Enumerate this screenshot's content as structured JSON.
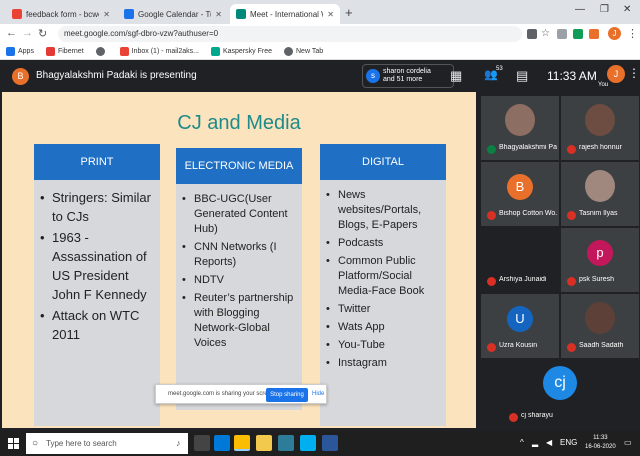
{
  "browser": {
    "tabs": [
      {
        "label": "feedback form - bcwcc.journalis",
        "favicon_color": "#ea4335"
      },
      {
        "label": "Google Calendar - Tuesday, June",
        "favicon_color": "#1a73e8"
      },
      {
        "label": "Meet - International Webinar",
        "favicon_color": "#00897b",
        "active": true
      }
    ],
    "new_tab": "+",
    "window_controls": {
      "minimize": "—",
      "maximize": "❐",
      "close": "✕"
    },
    "url": "meet.google.com/sgf-dbro-vzw?authuser=0",
    "profile_letter": "J",
    "bookmarks": [
      {
        "label": "Apps",
        "color": "#1a73e8"
      },
      {
        "label": "Fibernet",
        "color": "#e53935"
      },
      {
        "label": "",
        "color": "#5f6368"
      },
      {
        "label": "Inbox (1) - mail2aks...",
        "color": "#ea4335"
      },
      {
        "label": "Kaspersky Free",
        "color": "#00a88e"
      },
      {
        "label": "New Tab",
        "color": "#5f6368"
      }
    ]
  },
  "meet": {
    "presenter_initial": "B",
    "presenter_text": "Bhagyalakshmi Padaki is presenting",
    "people_initial": "s",
    "people_line1": "sharon cordelia",
    "people_line2": "and 51 more",
    "participant_count": "53",
    "clock": "11:33 AM",
    "you_initial": "J",
    "you_label": "You",
    "share_message": "meet.google.com is sharing your screen.",
    "stop_sharing": "Stop sharing",
    "hide": "Hide",
    "participants": [
      {
        "name": "Bhagyalakshmi Pa...",
        "initial": "",
        "color": "#8d6e63"
      },
      {
        "name": "rajesh honnur",
        "initial": "",
        "color": "#6d4c41"
      },
      {
        "name": "Bishop Cotton Wo...",
        "initial": "B",
        "color": "#e8702a"
      },
      {
        "name": "Tasnim Ilyas",
        "initial": "",
        "color": "#a1887f"
      },
      {
        "name": "Arshiya Junaidi",
        "initial": "",
        "color": "#3c4043"
      },
      {
        "name": "psk Suresh",
        "initial": "p",
        "color": "#c2185b"
      },
      {
        "name": "Uzra Kousin",
        "initial": "U",
        "color": "#1565c0"
      },
      {
        "name": "Saadh Sadath",
        "initial": "",
        "color": "#5d4037"
      },
      {
        "name": "cj sharayu",
        "initial": "cj",
        "color": "#1e88e5"
      }
    ]
  },
  "slide": {
    "title": "CJ and Media",
    "columns": [
      {
        "heading": "PRINT",
        "items": [
          "Stringers: Similar to CJs",
          "1963 - Assassination of US President John F Kennedy",
          "Attack on WTC 2011"
        ]
      },
      {
        "heading": "ELECTRONIC MEDIA",
        "items": [
          "BBC-UGC(User Generated Content Hub)",
          "CNN Networks    (I Reports)",
          "NDTV",
          "Reuter’s partnership with Blogging Network-Global Voices"
        ]
      },
      {
        "heading": "DIGITAL",
        "items": [
          "News websites/Portals, Blogs, E-Papers",
          "Podcasts",
          "Common Public Platform/Social Media-Face Book",
          "Twitter",
          "Wats App",
          "You-Tube",
          "Instagram"
        ]
      }
    ]
  },
  "taskbar": {
    "search_placeholder": "Type here to search",
    "time": "11:33",
    "date": "16-06-2020",
    "language": "ENG"
  },
  "colors": {
    "meet_bg": "#202124",
    "slide_bg": "#fbe4bd",
    "column_header": "#1f6fc4",
    "title_teal": "#1e8a8a"
  }
}
